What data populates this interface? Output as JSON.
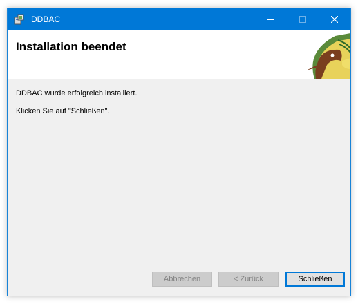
{
  "window": {
    "title": "DDBAC",
    "title_bar_color": "#0078d7",
    "controls": {
      "minimize": "minimize-icon",
      "maximize": "maximize-icon",
      "close": "close-icon"
    }
  },
  "header": {
    "title": "Installation beendet",
    "logo": "ddbac-bird-logo"
  },
  "body": {
    "line1": "DDBAC wurde erfolgreich installiert.",
    "line2": "Klicken Sie auf \"Schließen\"."
  },
  "buttons": {
    "cancel": {
      "label": "Abbrechen",
      "enabled": false
    },
    "back": {
      "label": "< Zurück",
      "enabled": false
    },
    "close": {
      "label": "Schließen",
      "enabled": true
    }
  }
}
